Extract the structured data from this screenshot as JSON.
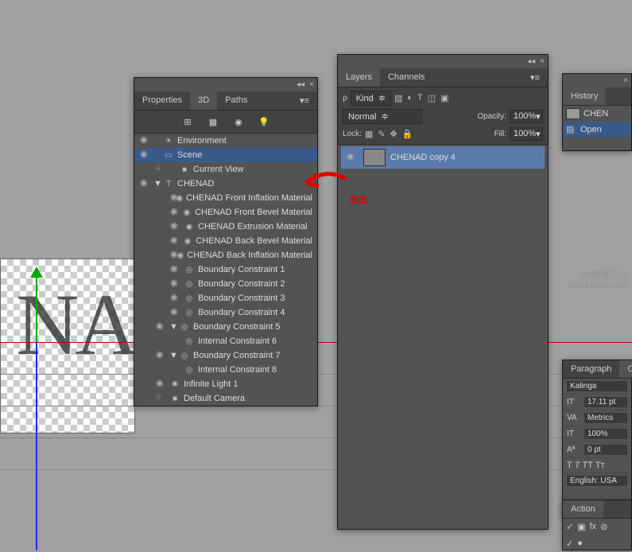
{
  "watermark": {
    "l1": "PS教程论坛",
    "l2": "bbs.16xx8.com"
  },
  "annotation_text": "双击",
  "panel3d": {
    "tabs": {
      "properties": "Properties",
      "d3": "3D",
      "paths": "Paths"
    },
    "toolbar_icons": {
      "filter": "filter-icon",
      "grid": "grid-icon",
      "pin": "pin-icon",
      "bulb": "bulb-icon"
    },
    "tree": {
      "environment": "Environment",
      "scene": "Scene",
      "current_view": "Current View",
      "chenad": "CHENAD",
      "mat_front_inflation": "CHENAD Front Inflation Material",
      "mat_front_bevel": "CHENAD Front Bevel Material",
      "mat_extrusion": "CHENAD Extrusion Material",
      "mat_back_bevel": "CHENAD Back Bevel Material",
      "mat_back_inflation": "CHENAD Back Inflation Material",
      "bc1": "Boundary Constraint 1",
      "bc2": "Boundary Constraint 2",
      "bc3": "Boundary Constraint 3",
      "bc4": "Boundary Constraint 4",
      "bc5": "Boundary Constraint 5",
      "ic6": "Internal Constraint 6",
      "bc7": "Boundary Constraint 7",
      "ic8": "Internal Constraint 8",
      "infinite_light": "Infinite Light 1",
      "default_camera": "Default Camera"
    }
  },
  "layers": {
    "tabs": {
      "layers": "Layers",
      "channels": "Channels"
    },
    "kind_label": "Kind",
    "mode": "Normal",
    "opacity_label": "Opacity:",
    "opacity_value": "100%",
    "lock_label": "Lock:",
    "fill_label": "Fill:",
    "fill_value": "100%",
    "layer_name": "CHENAD copy 4"
  },
  "history": {
    "tab": "History",
    "doc": "CHEN",
    "step": "Open"
  },
  "character": {
    "tabs": {
      "paragraph": "Paragraph",
      "char": "Cha"
    },
    "font": "Kalinga",
    "size": "17.11 pt",
    "tracking": "Metrics",
    "vscale": "100%",
    "baseline": "0 pt",
    "lang": "English: USA"
  },
  "actions": {
    "tab": "Action"
  }
}
